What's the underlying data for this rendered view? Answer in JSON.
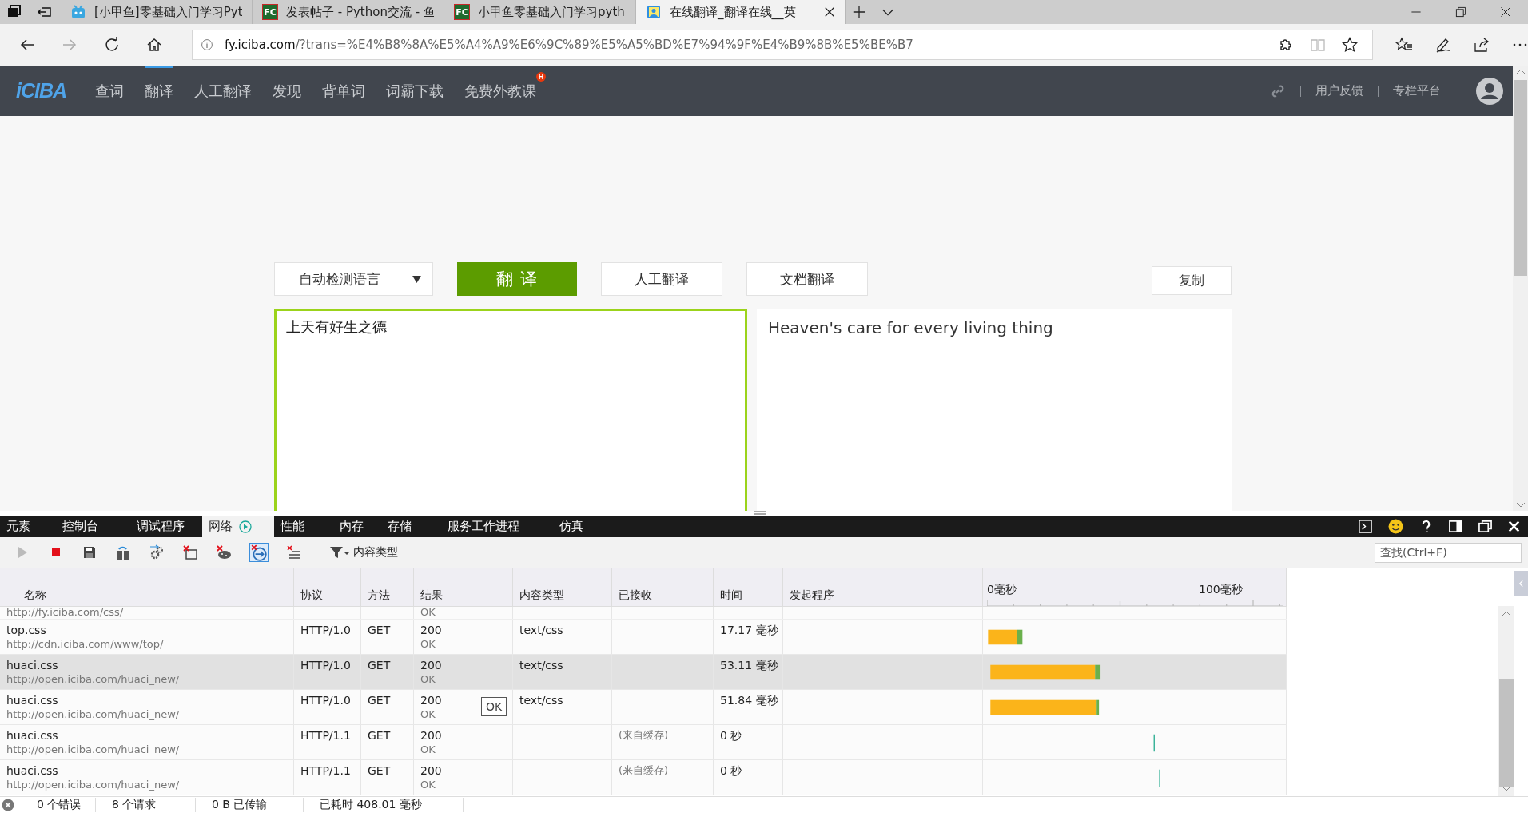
{
  "browser": {
    "tabs": [
      {
        "title": "[小甲鱼]零基础入门学习Pyt",
        "selected": false,
        "kind": "robot"
      },
      {
        "title": "发表帖子 - Python交流 - 鱼",
        "selected": false,
        "kind": "lettered",
        "favicon_text": "FC"
      },
      {
        "title": "小甲鱼零基础入门学习pyth",
        "selected": false,
        "kind": "lettered",
        "favicon_text": "FC"
      },
      {
        "title": "在线翻译_翻译在线__英",
        "selected": true,
        "kind": "card"
      }
    ],
    "url_host": "fy.iciba.com",
    "url_rest": "/?trans=%E4%B8%8A%E5%A4%A9%E6%9C%89%E5%A5%BD%E7%94%9F%E4%B9%8B%E5%BE%B7"
  },
  "site": {
    "logo": "iCIBA",
    "nav": [
      {
        "label": "查词",
        "selected": false
      },
      {
        "label": "翻译",
        "selected": true
      },
      {
        "label": "人工翻译",
        "selected": false
      },
      {
        "label": "发现",
        "selected": false
      },
      {
        "label": "背单词",
        "selected": false
      },
      {
        "label": "词霸下载",
        "selected": false
      },
      {
        "label": "免费外教课",
        "selected": false,
        "badge": "H"
      }
    ],
    "links": [
      "用户反馈",
      "专栏平台"
    ]
  },
  "translator": {
    "language": "自动检测语言",
    "translate": "翻 译",
    "human": "人工翻译",
    "document": "文档翻译",
    "copy": "复制",
    "input": "上天有好生之德",
    "output": "Heaven's care for every living thing"
  },
  "devtools": {
    "tabs": [
      {
        "label": "元素",
        "selected": false
      },
      {
        "label": "控制台",
        "selected": false
      },
      {
        "label": "调试程序",
        "selected": false
      },
      {
        "label": "网络",
        "selected": true,
        "kind": "play"
      },
      {
        "label": "性能",
        "selected": false
      },
      {
        "label": "内存",
        "selected": false
      },
      {
        "label": "存储",
        "selected": false
      },
      {
        "label": "服务工作进程",
        "selected": false
      },
      {
        "label": "仿真",
        "selected": false
      }
    ],
    "filter": "内容类型",
    "search": {
      "placeholder": "查找(Ctrl+F)"
    },
    "columns": [
      "名称",
      "协议",
      "方法",
      "结果",
      "内容类型",
      "已接收",
      "时间",
      "发起程序"
    ],
    "timeline_ticks": [
      "0毫秒",
      "100毫秒"
    ],
    "partial_row": {
      "url": "http://fy.iciba.com/css/",
      "status_text": "OK"
    },
    "rows": [
      {
        "name": "top.css",
        "url": "http://cdn.iciba.com/www/top/",
        "protocol": "HTTP/1.0",
        "method": "GET",
        "status": "200",
        "status_text": "OK",
        "content_type": "text/css",
        "time": "17.17 毫秒",
        "selected": false
      },
      {
        "name": "huaci.css",
        "url": "http://open.iciba.com/huaci_new/",
        "protocol": "HTTP/1.0",
        "method": "GET",
        "status": "200",
        "status_text": "OK",
        "content_type": "text/css",
        "time": "53.11 毫秒",
        "selected": true
      },
      {
        "name": "huaci.css",
        "url": "http://open.iciba.com/huaci_new/",
        "protocol": "HTTP/1.0",
        "method": "GET",
        "status": "200",
        "status_text": "OK",
        "content_type": "text/css",
        "time": "51.84 毫秒",
        "selected": false,
        "tooltip": "OK"
      },
      {
        "name": "huaci.css",
        "url": "http://open.iciba.com/huaci_new/",
        "protocol": "HTTP/1.1",
        "method": "GET",
        "status": "200",
        "status_text": "OK",
        "received": "(来自缓存)",
        "time": "0 秒",
        "selected": false
      },
      {
        "name": "huaci.css",
        "url": "http://open.iciba.com/huaci_new/",
        "protocol": "HTTP/1.1",
        "method": "GET",
        "status": "200",
        "status_text": "OK",
        "received": "(来自缓存)",
        "time": "0 秒",
        "selected": false
      }
    ],
    "status_bar": [
      "0 个错误",
      "8 个请求",
      "0 B 已传输",
      "已耗时 408.01 毫秒"
    ]
  }
}
